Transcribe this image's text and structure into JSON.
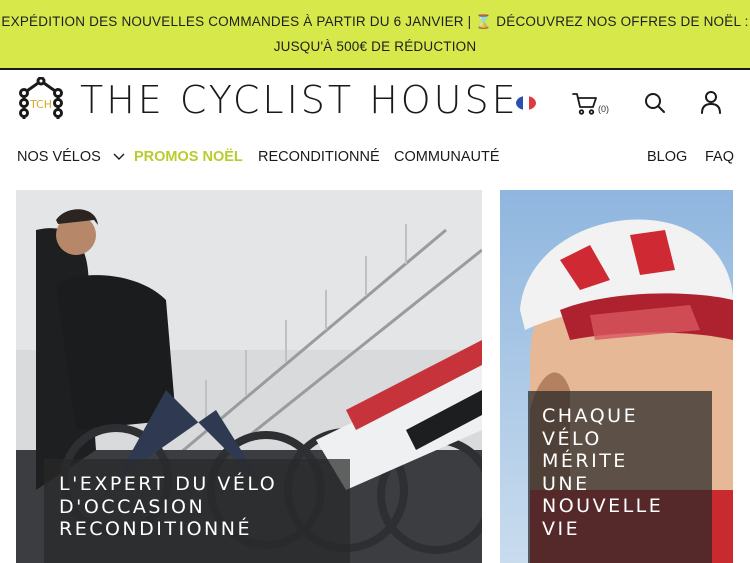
{
  "promo_bar": {
    "line1": "EXPÉDITION DES NOUVELLES COMMANDES À PARTIR DU 6 JANVIER | ⌛ DÉCOUVREZ NOS OFFRES DE NOËL :",
    "line2": "JUSQU'À 500€ DE RÉDUCTION",
    "background": "#d6e84a"
  },
  "header": {
    "logo_initials": "TCH",
    "logo_text": "THE CYCLIST HOUSE",
    "language_icon": "france-flag-icon",
    "cart_icon": "cart-icon",
    "cart_count": "(0)",
    "search_icon": "search-icon",
    "account_icon": "user-icon"
  },
  "nav": {
    "items": [
      {
        "label": "NOS VÉLOS",
        "has_dropdown": true
      },
      {
        "label": "PROMOS NOËL",
        "accent": "#b9cc2d"
      },
      {
        "label": "RECONDITIONNÉ"
      },
      {
        "label": "COMMUNAUTÉ"
      },
      {
        "label": "BLOG"
      },
      {
        "label": "FAQ"
      }
    ]
  },
  "hero": {
    "left": {
      "line1": "L'EXPERT DU VÉLO",
      "line2": "D'OCCASION",
      "line3": "RECONDITIONNÉ"
    },
    "right": {
      "line1": "CHAQUE",
      "line2": "VÉLO",
      "line3": "MÉRITE",
      "line4": "UNE",
      "line5": "NOUVELLE",
      "line6": "VIE"
    }
  }
}
